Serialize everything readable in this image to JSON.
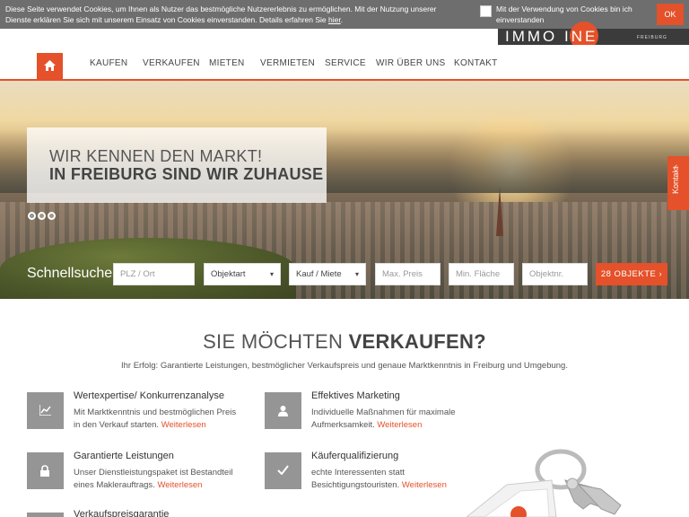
{
  "cookie": {
    "text_before": "Diese Seite verwendet Cookies, um Ihnen als Nutzer das bestmögliche Nutzererlebnis zu ermöglichen. Mit der Nutzung unserer Dienste erklären Sie sich mit unserem Einsatz von Cookies einverstanden. Details erfahren Sie ",
    "link": "hier",
    "checkbox_label": "Mit der Verwendung von Cookies bin ich einverstanden",
    "ok": "OK"
  },
  "logo": {
    "text": "IMMO  INE",
    "sub": "FREIBURG"
  },
  "nav": {
    "items": [
      "KAUFEN",
      "VERKAUFEN",
      "MIETEN",
      "VERMIETEN",
      "SERVICE",
      "WIR ÜBER UNS",
      "KONTAKT"
    ]
  },
  "hero": {
    "line1": "WIR KENNEN DEN MARKT!",
    "line2": "IN FREIBURG SIND WIR ZUHAUSE",
    "side_tab": "Kontakt"
  },
  "quicksearch": {
    "label": "Schnellsuche",
    "plz_placeholder": "PLZ / Ort",
    "objektart": "Objektart",
    "kauf_miete": "Kauf / Miete",
    "preis_placeholder": "Max. Preis",
    "flaeche_placeholder": "Min. Fläche",
    "objektnr_placeholder": "Objektnr.",
    "button": "28 OBJEKTE"
  },
  "section": {
    "title_light": "SIE MÖCHTEN ",
    "title_bold": "VERKAUFEN?",
    "subtitle": "Ihr Erfolg: Garantierte Leistungen, bestmöglicher Verkaufspreis und genaue Marktkenntnis in Freiburg und Umgebung."
  },
  "features": [
    {
      "title": "Wertexpertise/ Konkurrenzanalyse",
      "text": "Mit Marktkenntnis und bestmöglichen Preis in den Verkauf starten. ",
      "link": "Weiterlesen"
    },
    {
      "title": "Effektives Marketing",
      "text": "Individuelle Maßnahmen für maximale Aufmerksamkeit. ",
      "link": "Weiterlesen"
    },
    {
      "title": "Garantierte Leistungen",
      "text": "Unser Dienstleistungspaket ist Bestandteil eines Maklerauftrags. ",
      "link": "Weiterlesen"
    },
    {
      "title": "Käuferqualifizierung",
      "text": "echte Interessenten statt Besichtigungstouristen. ",
      "link": "Weiterlesen"
    },
    {
      "title": "Verkaufspreisgarantie"
    }
  ],
  "colors": {
    "accent": "#e4512a",
    "icon_bg": "#959595",
    "cookie_bg": "#6e6e6e"
  }
}
